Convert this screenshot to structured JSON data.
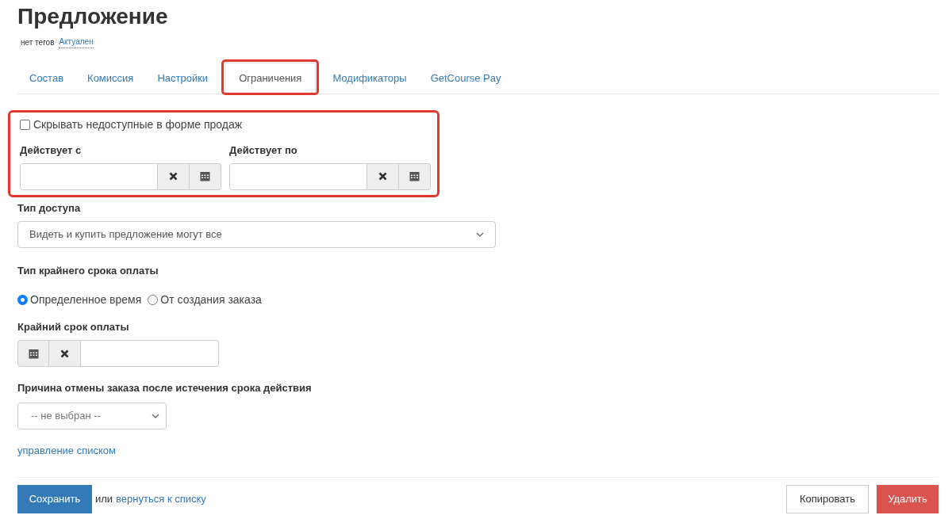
{
  "title": "Предложение",
  "tags": {
    "text": "нет тегов",
    "status": "Актуален"
  },
  "tabs": [
    {
      "label": "Состав",
      "selected": false,
      "highlighted": false
    },
    {
      "label": "Комиссия",
      "selected": false,
      "highlighted": false
    },
    {
      "label": "Настройки",
      "selected": false,
      "highlighted": false
    },
    {
      "label": "Ограничения",
      "selected": true,
      "highlighted": true
    },
    {
      "label": "Модификаторы",
      "selected": false,
      "highlighted": false
    },
    {
      "label": "GetCourse Pay",
      "selected": false,
      "highlighted": false
    }
  ],
  "validity": {
    "highlighted": true,
    "hide_unavailable": {
      "label": "Скрывать недоступные в форме продаж",
      "checked": false
    },
    "from": {
      "label": "Действует с"
    },
    "to": {
      "label": "Действует по"
    }
  },
  "access_type": {
    "label": "Тип доступа",
    "value": "Видеть и купить предложение могут все"
  },
  "deadline_type": {
    "label": "Тип крайнего срока оплаты",
    "options": [
      {
        "label": "Определенное время",
        "selected": true
      },
      {
        "label": "От создания заказа",
        "selected": false
      }
    ]
  },
  "deadline": {
    "label": "Крайний срок оплаты"
  },
  "cancel_reason": {
    "label": "Причина отмены заказа после истечения срока действия",
    "value": "-- не выбран --",
    "manage_link": "управление списком"
  },
  "footer": {
    "save": "Сохранить",
    "or": "или",
    "back_link": "вернуться к списку",
    "copy": "Копировать",
    "delete": "Удалить"
  }
}
